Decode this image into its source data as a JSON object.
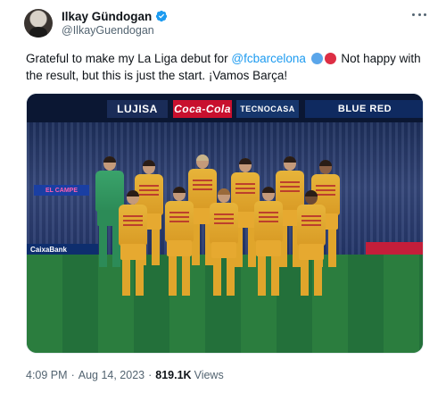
{
  "author": {
    "display_name": "Ilkay Gündogan",
    "handle": "@IlkayGuendogan",
    "verified": true,
    "verified_color": "#1d9bf0"
  },
  "tweet": {
    "text_before": "Grateful to make my La Liga debut for ",
    "mention": "@fcbarcelona",
    "text_after": " Not happy with the result, but this is just the start. ¡Vamos Barça!",
    "emojis": [
      "blue-circle",
      "red-circle"
    ]
  },
  "media": {
    "stadium_boards": {
      "lujisa": "LUJISA",
      "coca_cola": "Coca-Cola",
      "tecnocasa": "TECNOCASA",
      "blue_red": "BLUE RED",
      "left_board": "EL CAMPE",
      "caixabank": "CaixaBank"
    },
    "players_visible": 11
  },
  "meta": {
    "time": "4:09 PM",
    "separator": "·",
    "date": "Aug 14, 2023",
    "views_count": "819.1K",
    "views_label": "Views"
  },
  "colors": {
    "text": "#0f1419",
    "secondary": "#536471",
    "link": "#1d9bf0"
  }
}
